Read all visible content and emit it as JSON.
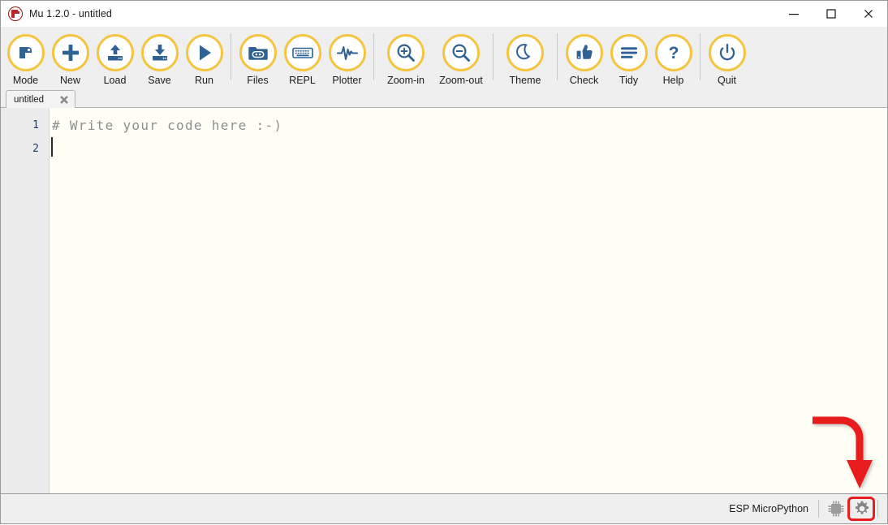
{
  "window": {
    "title": "Mu 1.2.0 - untitled",
    "logo_icon": "mu-logo-icon",
    "controls": [
      {
        "name": "minimize-button",
        "icon": "minimize-icon",
        "label": "Minimize"
      },
      {
        "name": "maximize-button",
        "icon": "maximize-icon",
        "label": "Maximize"
      },
      {
        "name": "close-button",
        "icon": "close-icon",
        "label": "Close"
      }
    ]
  },
  "toolbar": {
    "buttons": [
      {
        "label": "Mode",
        "icon": "mu-mode-icon"
      },
      {
        "label": "New",
        "icon": "plus-icon"
      },
      {
        "label": "Load",
        "icon": "upload-drive-icon"
      },
      {
        "label": "Save",
        "icon": "download-drive-icon"
      },
      {
        "label": "Run",
        "icon": "play-icon"
      },
      {
        "label": "Files",
        "icon": "folder-robot-icon"
      },
      {
        "label": "REPL",
        "icon": "keyboard-icon"
      },
      {
        "label": "Plotter",
        "icon": "waveform-icon"
      },
      {
        "label": "Zoom-in",
        "icon": "magnifier-plus-icon"
      },
      {
        "label": "Zoom-out",
        "icon": "magnifier-minus-icon"
      },
      {
        "label": "Theme",
        "icon": "moon-icon"
      },
      {
        "label": "Check",
        "icon": "thumbs-up-icon"
      },
      {
        "label": "Tidy",
        "icon": "lines-icon"
      },
      {
        "label": "Help",
        "icon": "question-mark-icon"
      },
      {
        "label": "Quit",
        "icon": "power-icon"
      }
    ],
    "separators_after": [
      "Run",
      "Plotter",
      "Zoom-out",
      "Theme",
      "Help"
    ],
    "accent_ring_color": "#F5C542",
    "icon_color": "#2F6293"
  },
  "tabs": [
    {
      "label": "untitled",
      "close_icon": "close-x-icon"
    }
  ],
  "editor": {
    "line_numbers": [
      "1",
      "2"
    ],
    "lines": [
      "# Write your code here :-)",
      ""
    ],
    "background_color": "#FFFFF5",
    "gutter_color": "#ECECEC",
    "comment_color": "#8E8E8E"
  },
  "statusbar": {
    "mode_label": "ESP MicroPython",
    "chip_icon": "microchip-icon",
    "gear_icon": "gear-icon"
  },
  "annotation": {
    "arrow_color": "#E81D1D",
    "highlight_color": "#E81D1D",
    "arrow_icon": "curved-down-arrow-icon",
    "target": "gear-icon"
  }
}
